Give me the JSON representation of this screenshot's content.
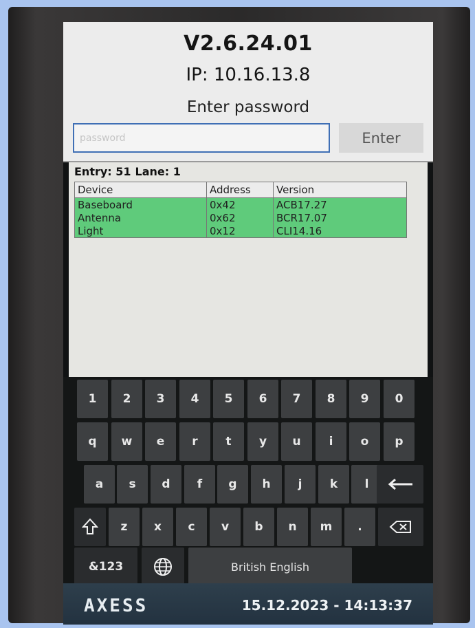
{
  "header": {
    "version": "V2.6.24.01",
    "ip": "IP: 10.16.13.8",
    "prompt": "Enter password"
  },
  "password": {
    "placeholder": "password",
    "value": "",
    "enter_label": "Enter"
  },
  "status": {
    "entry_label": "Entry: 51",
    "lane_label": "Lane: 1"
  },
  "devices": {
    "columns": [
      "Device",
      "Address",
      "Version"
    ],
    "rows": [
      [
        "Baseboard",
        "0x42",
        "ACB17.27"
      ],
      [
        "Antenna",
        "0x62",
        "BCR17.07"
      ],
      [
        "Light",
        "0x12",
        "CLI14.16"
      ]
    ],
    "row_color": "#5fcb7b"
  },
  "keyboard": {
    "row1": [
      "1",
      "2",
      "3",
      "4",
      "5",
      "6",
      "7",
      "8",
      "9",
      "0"
    ],
    "row2": [
      "q",
      "w",
      "e",
      "r",
      "t",
      "y",
      "u",
      "i",
      "o",
      "p"
    ],
    "row3": [
      "a",
      "s",
      "d",
      "f",
      "g",
      "h",
      "j",
      "k",
      "l"
    ],
    "row4": [
      "z",
      "x",
      "c",
      "v",
      "b",
      "n",
      "m",
      "."
    ],
    "enter_icon": "enter-arrow-icon",
    "shift_icon": "shift-icon",
    "backspace_icon": "backspace-icon",
    "symbols_label": "&123",
    "globe_icon": "globe-icon",
    "space_label": "British English"
  },
  "footer": {
    "logo": "AXESS",
    "datetime": "15.12.2023 - 14:13:37"
  },
  "colors": {
    "accent_border": "#3f6fb5",
    "footer": "#2e3f4c"
  }
}
